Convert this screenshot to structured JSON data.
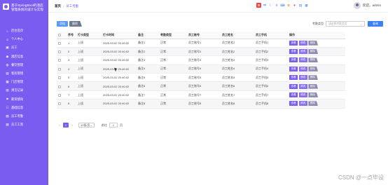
{
  "sidebar": {
    "title": "基于SpringBoot的酒店管理系统的设计与实现",
    "items": [
      {
        "label": "后台首页",
        "icon": "home-icon",
        "glyph": "⌂"
      },
      {
        "label": "个人中心",
        "icon": "user-icon",
        "glyph": "☺"
      },
      {
        "label": "员工",
        "icon": "staff-icon",
        "glyph": "▣"
      },
      {
        "label": "酒店信息",
        "icon": "hotel-icon",
        "glyph": "◉"
      },
      {
        "label": "餐饮管理",
        "icon": "food-icon",
        "glyph": "◍"
      },
      {
        "label": "客房管理",
        "icon": "room-icon",
        "glyph": "▤"
      },
      {
        "label": "门店管理",
        "icon": "store-icon",
        "glyph": "▦"
      },
      {
        "label": "清洁记录",
        "icon": "clean-icon",
        "glyph": "▥"
      },
      {
        "label": "薪资绩效",
        "icon": "flag-icon",
        "glyph": "⚑"
      },
      {
        "label": "基础信息",
        "icon": "info-icon",
        "glyph": "☷"
      },
      {
        "label": "员工考勤",
        "icon": "attendance-icon",
        "glyph": "▧"
      },
      {
        "label": "员工工资",
        "icon": "salary-icon",
        "glyph": "▨"
      }
    ]
  },
  "header": {
    "breadcrumb_home": "首页",
    "breadcrumb_separator": "/",
    "breadcrumb_current": "员工考勤",
    "user_label": "欢迎，admin",
    "toolbar_icons": [
      "S",
      "中",
      "☾",
      "⚲",
      "⌨",
      "✿",
      "♥",
      "▤",
      "▦"
    ]
  },
  "actions": {
    "add_label": "添加",
    "delete_label": "删除"
  },
  "filter": {
    "label": "考勤类型",
    "placeholder": "请选择考勤类型",
    "search_label": "查询"
  },
  "table": {
    "columns": [
      "",
      "序号",
      "打卡类型",
      "打卡时间",
      "备注",
      "考勤类型",
      "员工账号",
      "员工姓名",
      "员工手机",
      "操作"
    ],
    "rows": [
      {
        "index": "1",
        "punch_type": "上班",
        "time": "2025-03-02 20:40:02",
        "remark": "备注1",
        "attend_type": "正常",
        "account": "员工账号1",
        "name": "员工姓名1",
        "phone": "员工手机1"
      },
      {
        "index": "2",
        "punch_type": "上班",
        "time": "2025-03-02 20:40:02",
        "remark": "备注2",
        "attend_type": "正常",
        "account": "员工账号2",
        "name": "员工姓名2",
        "phone": "员工手机2"
      },
      {
        "index": "3",
        "punch_type": "上班",
        "time": "2025-03-02 20:40:02",
        "remark": "备注3",
        "attend_type": "正常",
        "account": "员工账号3",
        "name": "员工姓名3",
        "phone": "员工手机3"
      },
      {
        "index": "4",
        "punch_type": "上班",
        "time": "2025-03-02 20:40:02",
        "remark": "备注4",
        "attend_type": "正常",
        "account": "员工账号4",
        "name": "员工姓名4",
        "phone": "员工手机4"
      },
      {
        "index": "5",
        "punch_type": "上班",
        "time": "2025-03-02 20:40:02",
        "remark": "备注5",
        "attend_type": "正常",
        "account": "员工账号5",
        "name": "员工姓名5",
        "phone": "员工手机5"
      },
      {
        "index": "6",
        "punch_type": "上班",
        "time": "2025-03-02 20:40:02",
        "remark": "备注6",
        "attend_type": "正常",
        "account": "员工账号6",
        "name": "员工姓名6",
        "phone": "员工手机6"
      },
      {
        "index": "7",
        "punch_type": "上班",
        "time": "2025-03-02 20:40:02",
        "remark": "备注7",
        "attend_type": "正常",
        "account": "员工账号7",
        "name": "员工姓名7",
        "phone": "员工手机7"
      },
      {
        "index": "8",
        "punch_type": "上班",
        "time": "2025-03-02 20:40:02",
        "remark": "备注8",
        "attend_type": "正常",
        "account": "员工账号8",
        "name": "员工姓名8",
        "phone": "员工手机8"
      }
    ],
    "op_view": "查看",
    "op_edit": "修改",
    "op_delete": "删除"
  },
  "pagination": {
    "prev": "<",
    "current_page": "1",
    "next": ">",
    "page_size": "10条/页",
    "goto_label": "前往",
    "goto_value": "1",
    "page_suffix": "页"
  },
  "watermark": "CSDN @一点毕设",
  "colors": {
    "sidebar": "#7b5cf0",
    "primary": "#3d7ff5",
    "accent": "#7b5cf0"
  }
}
